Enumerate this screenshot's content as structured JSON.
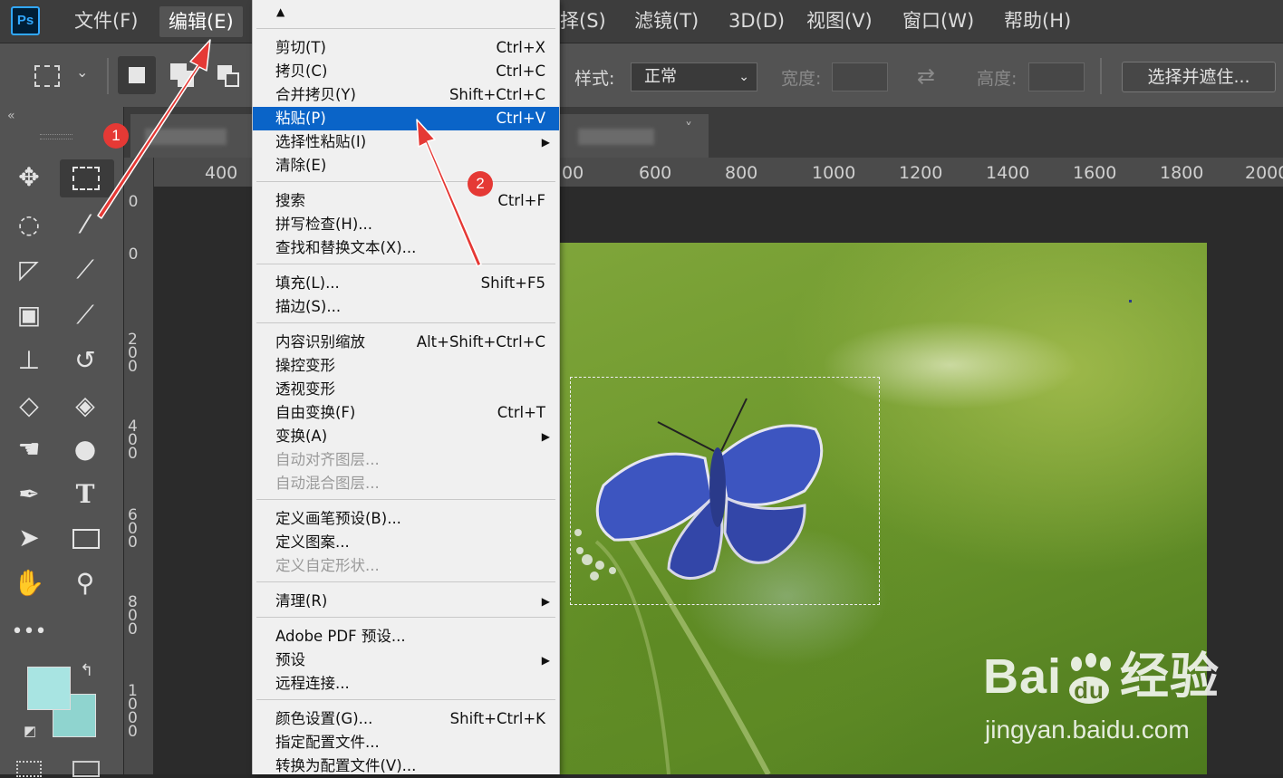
{
  "menubar": {
    "app_logo": "Ps",
    "items": [
      "文件(F)",
      "编辑(E)",
      "择(S)",
      "滤镜(T)",
      "3D(D)",
      "视图(V)",
      "窗口(W)",
      "帮助(H)"
    ]
  },
  "options_bar": {
    "style_label": "样式:",
    "style_value": "正常",
    "width_label": "宽度:",
    "height_label": "高度:",
    "select_mask_label": "选择并遮住..."
  },
  "rulers": {
    "horizontal": [
      "400",
      "00",
      "600",
      "800",
      "1000",
      "1200",
      "1400",
      "1600",
      "1800",
      "2000"
    ],
    "vertical": [
      "0",
      "0",
      "200",
      "400",
      "600",
      "800",
      "1000"
    ]
  },
  "tab_close": "˅",
  "edit_menu": {
    "scroll_up": "▲",
    "items": [
      {
        "label": "剪切(T)",
        "shortcut": "Ctrl+X"
      },
      {
        "label": "拷贝(C)",
        "shortcut": "Ctrl+C"
      },
      {
        "label": "合并拷贝(Y)",
        "shortcut": "Shift+Ctrl+C"
      },
      {
        "label": "粘贴(P)",
        "shortcut": "Ctrl+V"
      },
      {
        "label": "选择性粘贴(I)",
        "shortcut": ""
      },
      {
        "label": "清除(E)",
        "shortcut": ""
      },
      {
        "label": "搜索",
        "shortcut": "Ctrl+F"
      },
      {
        "label": "拼写检查(H)...",
        "shortcut": ""
      },
      {
        "label": "查找和替换文本(X)...",
        "shortcut": ""
      },
      {
        "label": "填充(L)...",
        "shortcut": "Shift+F5"
      },
      {
        "label": "描边(S)...",
        "shortcut": ""
      },
      {
        "label": "内容识别缩放",
        "shortcut": "Alt+Shift+Ctrl+C"
      },
      {
        "label": "操控变形",
        "shortcut": ""
      },
      {
        "label": "透视变形",
        "shortcut": ""
      },
      {
        "label": "自由变换(F)",
        "shortcut": "Ctrl+T"
      },
      {
        "label": "变换(A)",
        "shortcut": ""
      },
      {
        "label": "自动对齐图层...",
        "shortcut": ""
      },
      {
        "label": "自动混合图层...",
        "shortcut": ""
      },
      {
        "label": "定义画笔预设(B)...",
        "shortcut": ""
      },
      {
        "label": "定义图案...",
        "shortcut": ""
      },
      {
        "label": "定义自定形状...",
        "shortcut": ""
      },
      {
        "label": "清理(R)",
        "shortcut": ""
      },
      {
        "label": "Adobe PDF 预设...",
        "shortcut": ""
      },
      {
        "label": "预设",
        "shortcut": ""
      },
      {
        "label": "远程连接...",
        "shortcut": ""
      },
      {
        "label": "颜色设置(G)...",
        "shortcut": "Shift+Ctrl+K"
      },
      {
        "label": "指定配置文件...",
        "shortcut": ""
      },
      {
        "label": "转换为配置文件(V)...",
        "shortcut": ""
      }
    ],
    "highlighted_item": "粘贴(P)",
    "highlight_color": "#0a64c8",
    "disabled_items": [
      "自动对齐图层...",
      "自动混合图层...",
      "定义自定形状..."
    ],
    "submenu_items": [
      "选择性粘贴(I)",
      "变换(A)",
      "清理(R)",
      "预设"
    ]
  },
  "annotations": {
    "step1": "1",
    "step2": "2",
    "arrow_color": "#e53935"
  },
  "watermark": {
    "brand": "Bai",
    "brand_du": "du",
    "brand_cn": "经验",
    "url": "jingyan.baidu.com"
  },
  "colors": {
    "foreground": "#a8e4e2",
    "background": "#8fd4cf"
  }
}
